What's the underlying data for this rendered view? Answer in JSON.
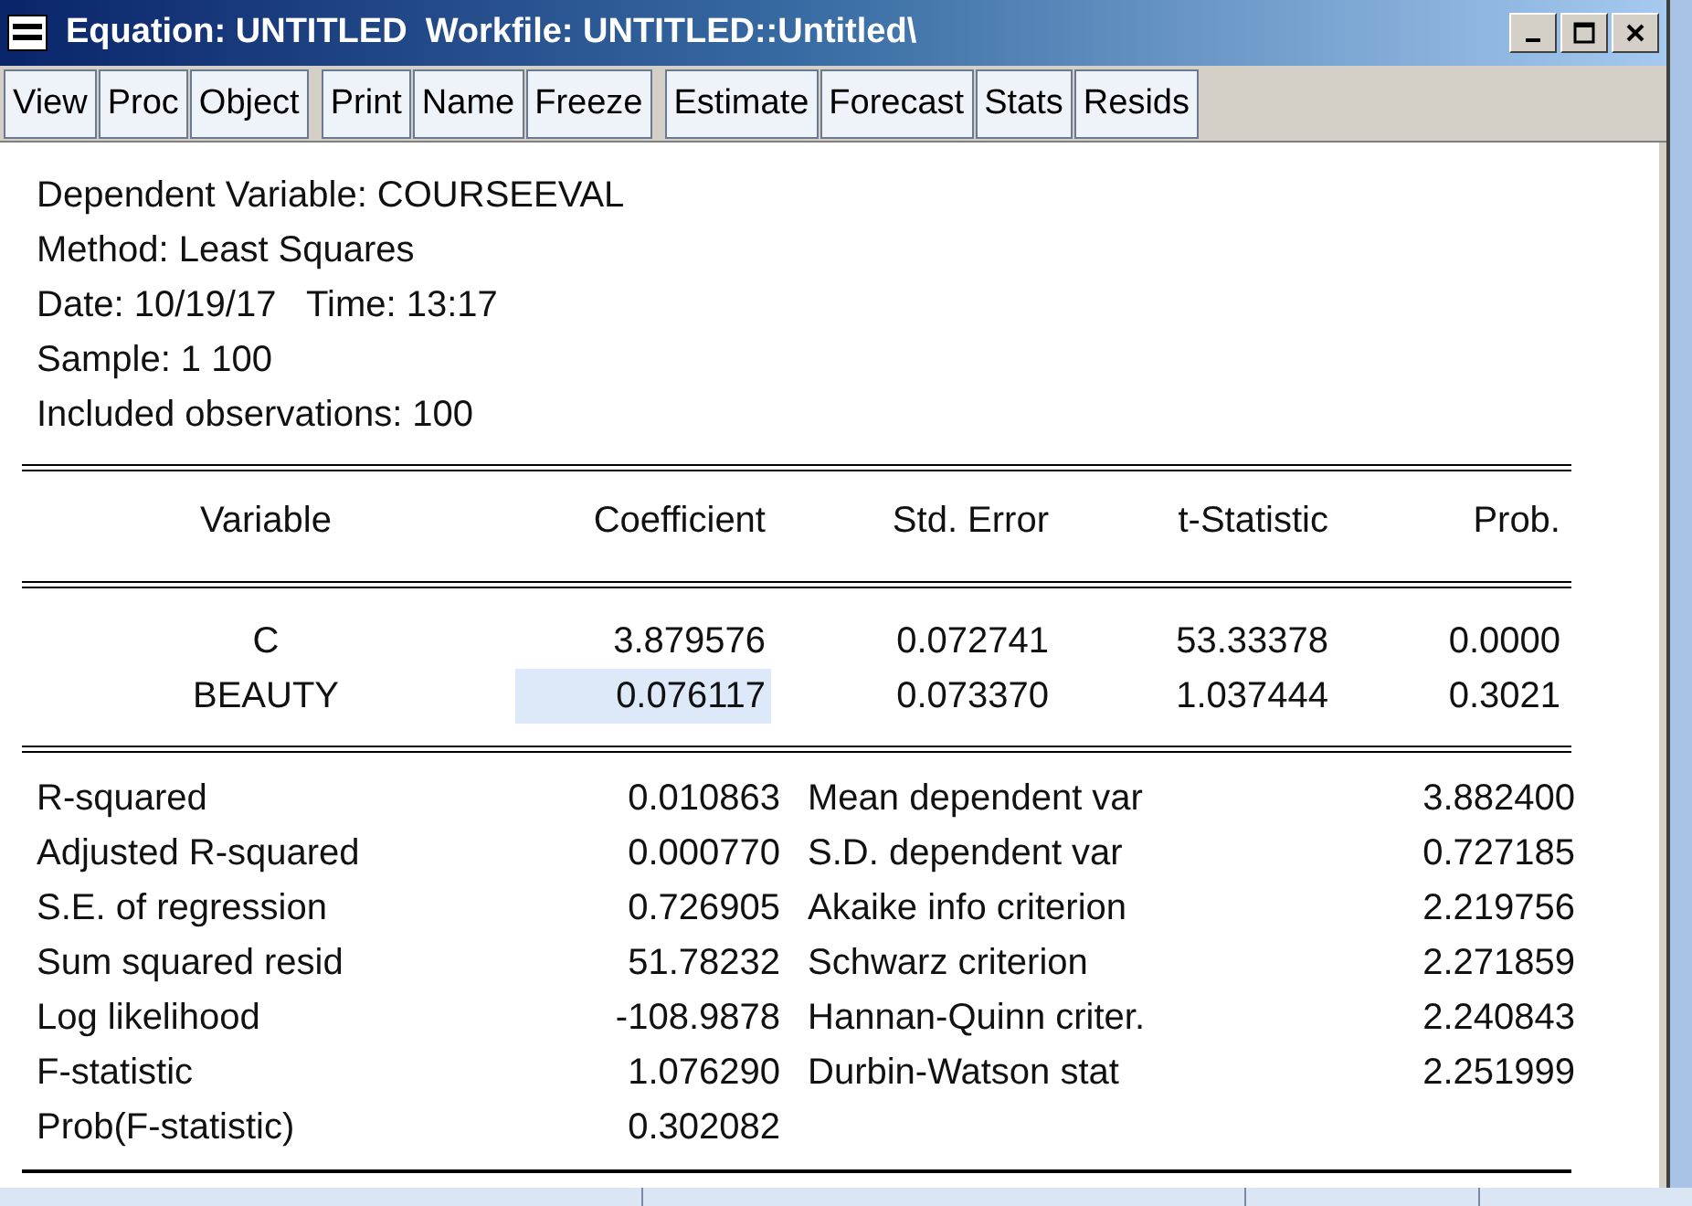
{
  "window": {
    "title": "Equation: UNTITLED",
    "workfile": "Workfile: UNTITLED::Untitled\\"
  },
  "toolbar": [
    [
      "View",
      "Proc",
      "Object"
    ],
    [
      "Print",
      "Name",
      "Freeze"
    ],
    [
      "Estimate",
      "Forecast",
      "Stats",
      "Resids"
    ]
  ],
  "header_lines": [
    "Dependent Variable: COURSEEVAL",
    "Method: Least Squares",
    "Date: 10/19/17   Time: 13:17",
    "Sample: 1 100",
    "Included observations: 100"
  ],
  "table": {
    "columns": [
      "Variable",
      "Coefficient",
      "Std. Error",
      "t-Statistic",
      "Prob."
    ],
    "rows": [
      [
        {
          "text": "C",
          "selected": false
        },
        {
          "text": "3.879576",
          "selected": false
        },
        {
          "text": "0.072741",
          "selected": false
        },
        {
          "text": "53.33378",
          "selected": false
        },
        {
          "text": "0.0000",
          "selected": false
        }
      ],
      [
        {
          "text": "BEAUTY",
          "selected": false
        },
        {
          "text": "0.076117",
          "selected": true
        },
        {
          "text": "0.073370",
          "selected": false
        },
        {
          "text": "1.037444",
          "selected": false
        },
        {
          "text": "0.3021",
          "selected": false
        }
      ]
    ]
  },
  "statistics": [
    [
      "R-squared",
      "0.010863",
      "Mean dependent var",
      "3.882400"
    ],
    [
      "Adjusted R-squared",
      "0.000770",
      "S.D. dependent var",
      "0.727185"
    ],
    [
      "S.E. of regression",
      "0.726905",
      "Akaike info criterion",
      "2.219756"
    ],
    [
      "Sum squared resid",
      "51.78232",
      "Schwarz criterion",
      "2.271859"
    ],
    [
      "Log likelihood",
      "-108.9878",
      "Hannan-Quinn criter.",
      "2.240843"
    ],
    [
      "F-statistic",
      "1.076290",
      "Durbin-Watson stat",
      "2.251999"
    ],
    [
      "Prob(F-statistic)",
      "0.302082"
    ]
  ]
}
